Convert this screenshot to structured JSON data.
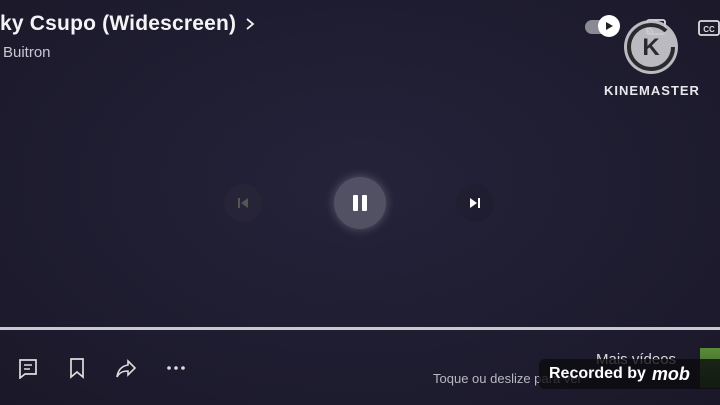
{
  "video": {
    "title": "ky Csupo (Widescreen)",
    "channel": "Buitron"
  },
  "icons": {
    "chevron": "chevron-right-icon",
    "autoplay": "autoplay-toggle-icon",
    "cast": "cast-icon",
    "cc": "closed-captions-icon",
    "previous": "skip-previous-icon",
    "pause": "pause-icon",
    "next": "skip-next-icon",
    "comments": "comment-icon",
    "save": "bookmark-icon",
    "share": "share-icon",
    "more": "more-horizontal-icon"
  },
  "watermark": {
    "kinemaster_letter": "K",
    "kinemaster_text": "KINEMASTER",
    "recorded_label": "Recorded by",
    "recorder_brand": "mob"
  },
  "end_screen": {
    "more_videos": "Mais vídeos",
    "hint": "Toque ou deslize para ver"
  },
  "player": {
    "state": "playing",
    "progress_fraction": 1.0
  },
  "colors": {
    "background": "#1e1c2f",
    "progress": "#c8c8d0"
  }
}
